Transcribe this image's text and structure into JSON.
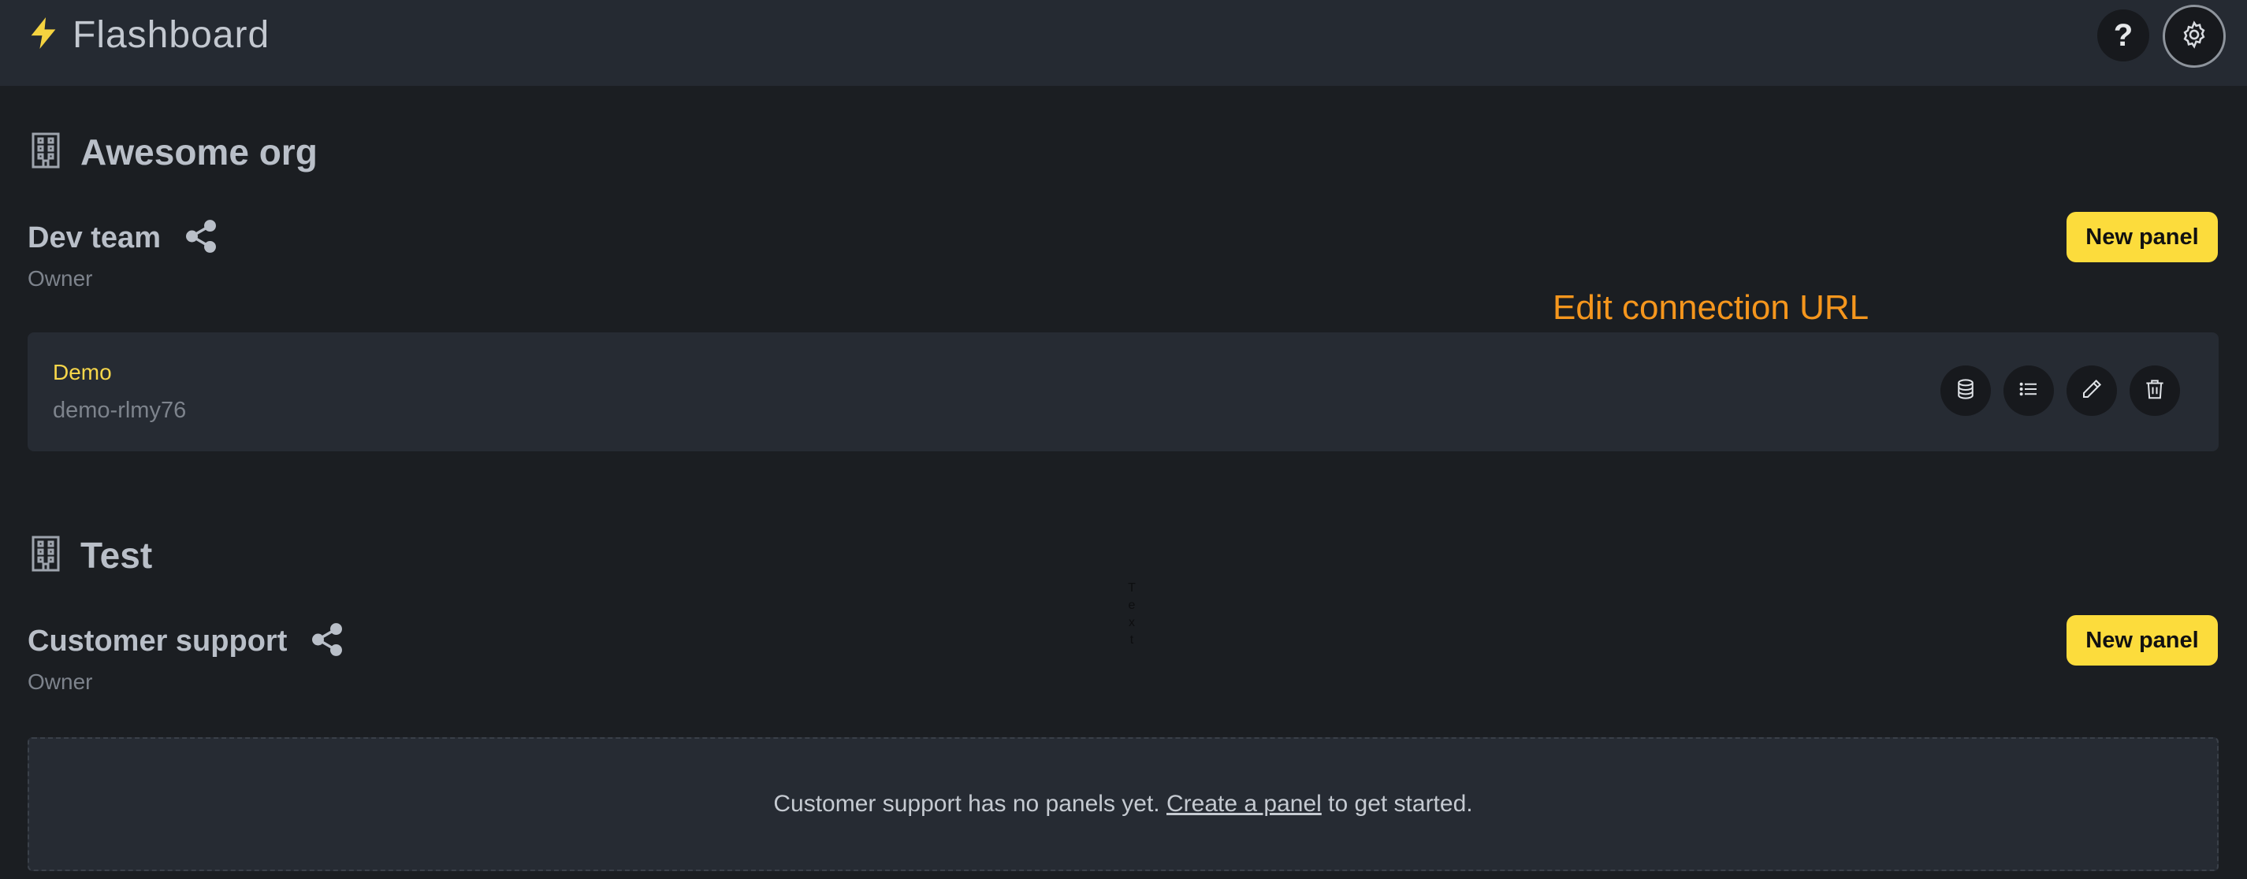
{
  "header": {
    "brand_name": "Flashboard",
    "brand_icon": "lightning-bolt-icon",
    "help_label": "?",
    "settings_icon": "gear-icon"
  },
  "colors": {
    "accent": "#fcdc3c",
    "background": "#1b1e22",
    "header_bg": "#252a32",
    "card_bg": "#262b33",
    "annotation": "#f5961d",
    "panel_name": "#f7d74a"
  },
  "orgs": [
    {
      "name": "Awesome org",
      "icon": "building-icon",
      "team": {
        "name": "Dev team",
        "role": "Owner",
        "share_icon": "share-icon",
        "new_panel_label": "New panel",
        "panels": [
          {
            "name": "Demo",
            "slug": "demo-rlmy76",
            "actions": [
              "database-icon",
              "list-icon",
              "pencil-icon",
              "trash-icon"
            ]
          }
        ]
      }
    },
    {
      "name": "Test",
      "icon": "building-icon",
      "team": {
        "name": "Customer support",
        "role": "Owner",
        "share_icon": "share-icon",
        "new_panel_label": "New panel",
        "empty_state": {
          "before": "Customer support has no panels yet.",
          "link": "Create a panel",
          "after": "to get started."
        }
      }
    }
  ],
  "annotation": {
    "text": "Edit connection URL"
  },
  "stray_text": "Text"
}
